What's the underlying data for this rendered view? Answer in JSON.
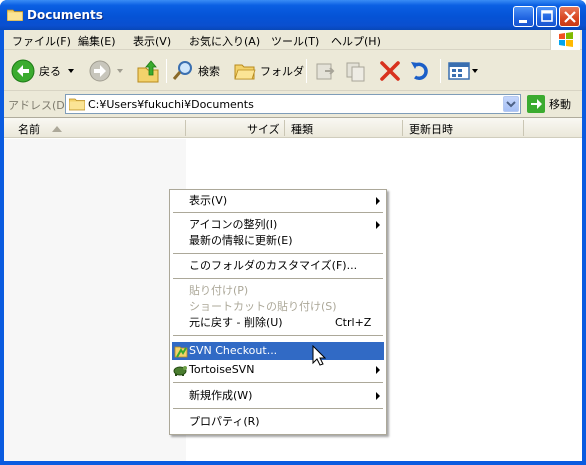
{
  "window": {
    "title": "Documents"
  },
  "menubar": {
    "items": [
      "ファイル(F)",
      "編集(E)",
      "表示(V)",
      "お気に入り(A)",
      "ツール(T)",
      "ヘルプ(H)"
    ]
  },
  "toolbar": {
    "back_label": "戻る",
    "search_label": "検索",
    "folders_label": "フォルダ"
  },
  "address": {
    "label": "アドレス(D)",
    "value": "C:¥Users¥fukuchi¥Documents",
    "go_label": "移動"
  },
  "columns": [
    "名前",
    "サイズ",
    "種類",
    "更新日時"
  ],
  "context_menu": {
    "items": [
      {
        "label": "表示(V)",
        "submenu": true
      },
      {
        "label": "アイコンの整列(I)",
        "submenu": true
      },
      {
        "label": "最新の情報に更新(E)"
      },
      {
        "label": "このフォルダのカスタマイズ(F)..."
      },
      {
        "label": "貼り付け(P)",
        "disabled": true
      },
      {
        "label": "ショートカットの貼り付け(S)",
        "disabled": true
      },
      {
        "label": "元に戻す - 削除(U)",
        "shortcut": "Ctrl+Z"
      },
      {
        "label": "SVN Checkout...",
        "highlighted": true,
        "icon": "svn-checkout-icon"
      },
      {
        "label": "TortoiseSVN",
        "submenu": true,
        "icon": "tortoisesvn-icon"
      },
      {
        "label": "新規作成(W)",
        "submenu": true
      },
      {
        "label": "プロパティ(R)"
      }
    ]
  },
  "colors": {
    "title_bar": "#0553d6",
    "highlight": "#316ac5",
    "window_frame": "#ece9d8"
  }
}
